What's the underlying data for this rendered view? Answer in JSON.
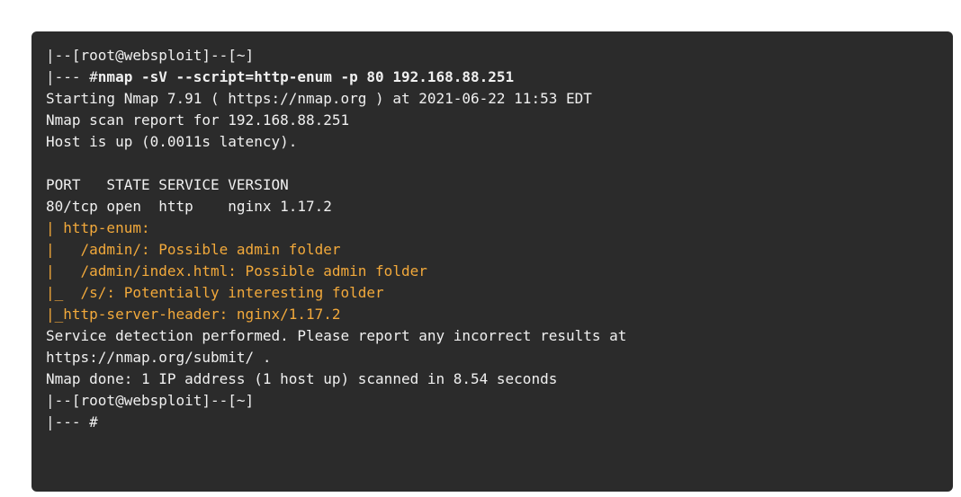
{
  "terminal": {
    "lines": [
      {
        "type": "prompt_top",
        "text": "|--[root@websploit]--[~]"
      },
      {
        "type": "command",
        "prefix": "|--- #",
        "command": "nmap -sV --script=http-enum -p 80 192.168.88.251"
      },
      {
        "type": "output",
        "text": "Starting Nmap 7.91 ( https://nmap.org ) at 2021-06-22 11:53 EDT"
      },
      {
        "type": "output",
        "text": "Nmap scan report for 192.168.88.251"
      },
      {
        "type": "output",
        "text": "Host is up (0.0011s latency)."
      },
      {
        "type": "blank",
        "text": ""
      },
      {
        "type": "output",
        "text": "PORT   STATE SERVICE VERSION"
      },
      {
        "type": "output",
        "text": "80/tcp open  http    nginx 1.17.2"
      },
      {
        "type": "script",
        "text": "| http-enum:"
      },
      {
        "type": "script",
        "text": "|   /admin/: Possible admin folder"
      },
      {
        "type": "script",
        "text": "|   /admin/index.html: Possible admin folder"
      },
      {
        "type": "script",
        "text": "|_  /s/: Potentially interesting folder"
      },
      {
        "type": "script",
        "text": "|_http-server-header: nginx/1.17.2"
      },
      {
        "type": "output",
        "text": "Service detection performed. Please report any incorrect results at"
      },
      {
        "type": "output",
        "text": "https://nmap.org/submit/ ."
      },
      {
        "type": "output",
        "text": "Nmap done: 1 IP address (1 host up) scanned in 8.54 seconds"
      },
      {
        "type": "prompt_top",
        "text": "|--[root@websploit]--[~]"
      },
      {
        "type": "prompt_bottom",
        "text": "|--- #"
      }
    ]
  },
  "colors": {
    "background": "#2b2b2b",
    "text": "#f0f0f0",
    "script_output": "#f2a93b"
  }
}
